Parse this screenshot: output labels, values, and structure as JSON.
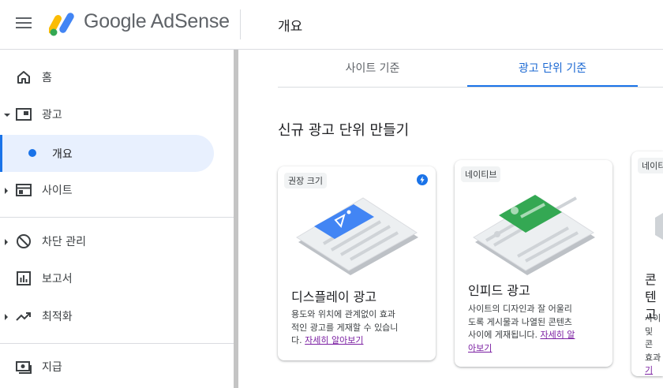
{
  "header": {
    "logo_text": "Google AdSense",
    "page_title": "개요",
    "icons": [
      "menu-icon",
      "adsense-logo"
    ]
  },
  "sidebar": {
    "items": [
      {
        "label": "홈",
        "icon": "home-icon"
      },
      {
        "label": "광고",
        "icon": "ads-icon",
        "expanded": true
      },
      {
        "label": "개요",
        "active": true
      },
      {
        "label": "사이트",
        "icon": "sites-icon"
      },
      {
        "label": "차단 관리",
        "icon": "block-icon"
      },
      {
        "label": "보고서",
        "icon": "report-icon"
      },
      {
        "label": "최적화",
        "icon": "trending-icon"
      },
      {
        "label": "지급",
        "icon": "payments-icon"
      }
    ]
  },
  "tabs": [
    {
      "label": "사이트 기준",
      "selected": false
    },
    {
      "label": "광고 단위 기준",
      "selected": true
    }
  ],
  "main": {
    "section_title": "신규 광고 단위 만들기",
    "cards": [
      {
        "badge": "권장 크기",
        "title": "디스플레이 광고",
        "desc_line1": "용도와 위치에 관계없이 효과",
        "desc_line2": "적인 광고를 게재할 수 있습니",
        "desc_line3_prefix": "다. ",
        "link": "자세히 알아보기",
        "flash_icon": true
      },
      {
        "badge": "네이티브",
        "title": "인피드 광고",
        "desc_line1": "사이트의 디자인과 잘 어울리",
        "desc_line2": "도록 게시물과 나열된 콘텐츠",
        "desc_line3_prefix": "사이에 게재됩니다. ",
        "link_part1": "자세히 알",
        "link_part2": "아보기"
      },
      {
        "badge": "네이티",
        "title_line1": "콘텐",
        "title_line2": "고",
        "desc_line1": "사이",
        "desc_line2": "및 콘",
        "desc_line3": "효과",
        "link": "기"
      }
    ]
  },
  "colors": {
    "accent": "#1a73e8",
    "active_bg": "#e8f0fe",
    "link": "#7b1fa2",
    "illustration_blue": "#4285f4",
    "illustration_green": "#34a853"
  }
}
